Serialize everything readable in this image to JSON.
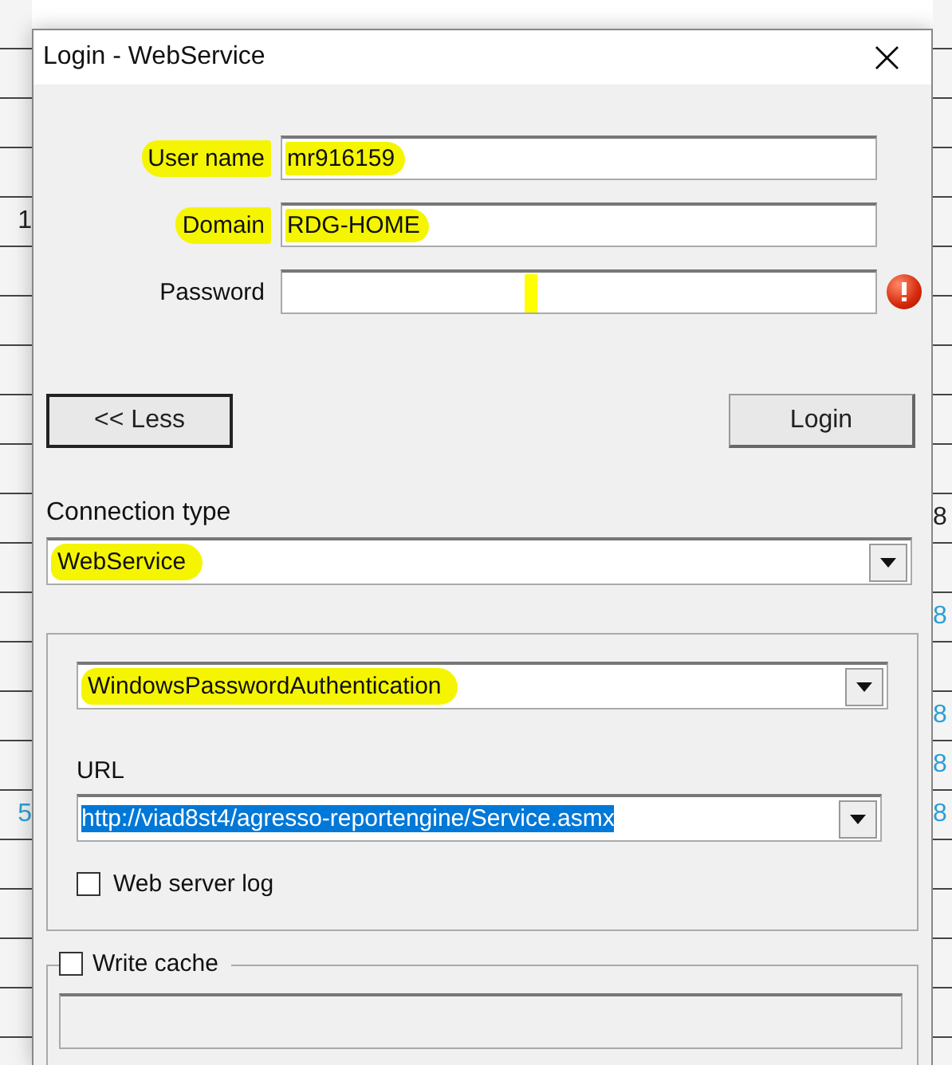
{
  "background_table": {
    "left_cells": [
      {
        "text": "1",
        "link": false
      },
      {
        "text": "5",
        "link": true
      }
    ],
    "right_cells": [
      {
        "text": "8",
        "link": false
      },
      {
        "text": "8",
        "link": true
      },
      {
        "text": "8",
        "link": true
      },
      {
        "text": "8",
        "link": true
      },
      {
        "text": "8",
        "link": true
      }
    ]
  },
  "window": {
    "title": "Login - WebService",
    "close": "×"
  },
  "fields": [
    {
      "label": "User name",
      "value": "mr916159",
      "highlighted": true,
      "error": false,
      "marked": false
    },
    {
      "label": "Domain",
      "value": "RDG-HOME",
      "highlighted": true,
      "error": false,
      "marked": false
    },
    {
      "label": "Password",
      "highlighted": false,
      "error": true,
      "marked": true
    }
  ],
  "buttons": {
    "less": "<< Less",
    "login": "Login"
  },
  "connection_type": {
    "label": "Connection type",
    "value": "WebService",
    "highlighted": true
  },
  "web_service": {
    "authentication": {
      "value": "WindowsPasswordAuthentication",
      "highlighted": true
    },
    "url": {
      "label": "URL",
      "value": "http://viad8st4/agresso-reportengine/Service.asmx",
      "selected": true
    },
    "web_server_log": {
      "label": "Web server log",
      "checked": false
    }
  },
  "write_cache": {
    "label": "Write cache",
    "checked": false
  }
}
